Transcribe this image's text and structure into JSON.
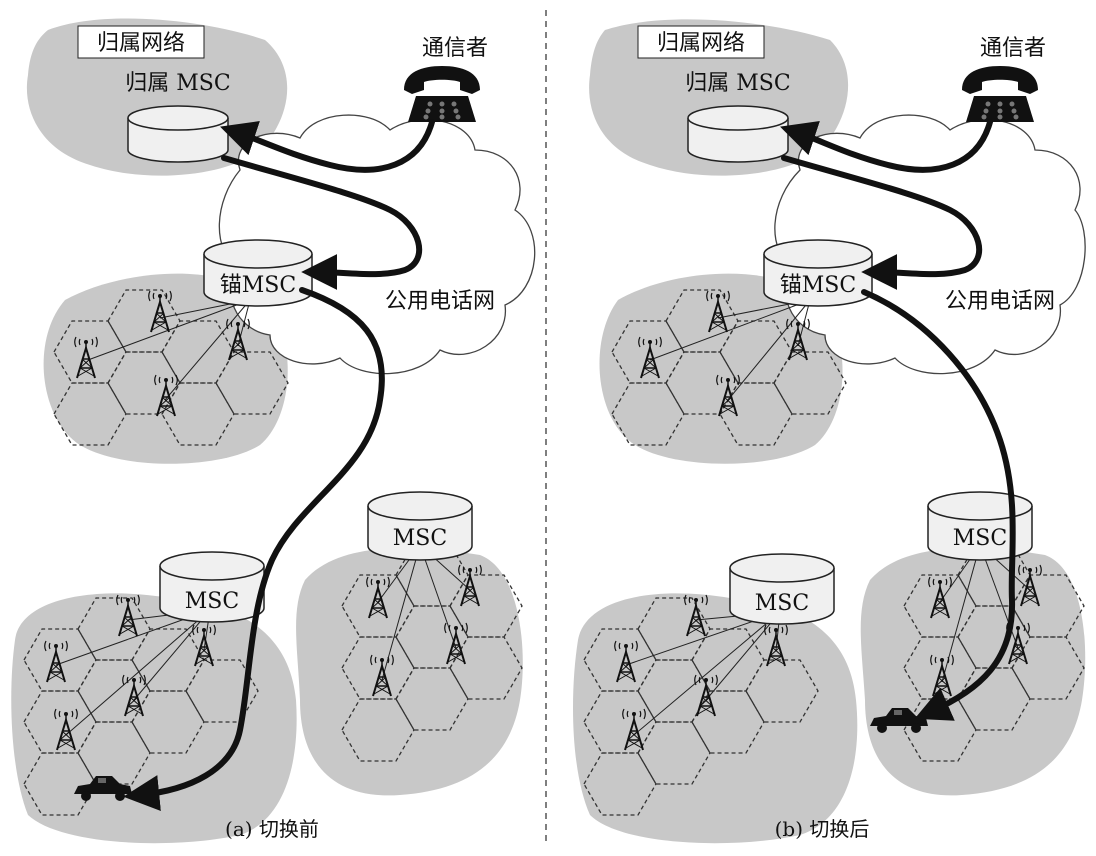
{
  "panels": [
    {
      "home_network_label": "归属网络",
      "home_msc_label": "归属 MSC",
      "caller_label": "通信者",
      "anchor_msc_label": "锚MSC",
      "pstn_label": "公用电话网",
      "msc_left_label": "MSC",
      "msc_right_label": "MSC",
      "caption": "(a) 切换前"
    },
    {
      "home_network_label": "归属网络",
      "home_msc_label": "归属 MSC",
      "caller_label": "通信者",
      "anchor_msc_label": "锚MSC",
      "pstn_label": "公用电话网",
      "msc_left_label": "MSC",
      "msc_right_label": "MSC",
      "caption": "(b) 切换后"
    }
  ],
  "colors": {
    "region_gray": "#c8c8c8",
    "cloud_fill": "#ffffff",
    "msc_fill": "#f0f0f0",
    "arrow": "#111111",
    "divider": "#555555"
  },
  "icons": {
    "tower": "cell-tower-icon",
    "phone": "telephone-icon",
    "car": "car-icon"
  }
}
